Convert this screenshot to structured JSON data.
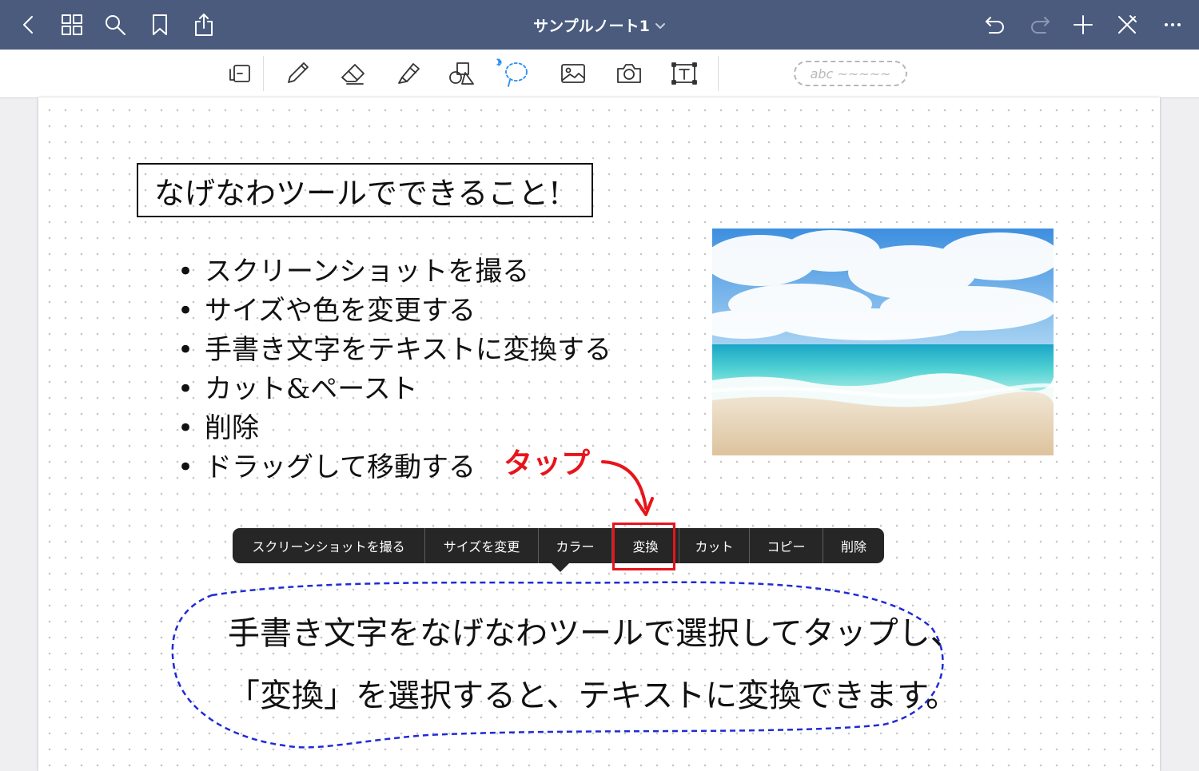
{
  "topbar": {
    "title": "サンプルノート1",
    "title_chevron": "chevron-down-icon",
    "left_icons": [
      "back-icon",
      "grid-icon",
      "search-icon",
      "bookmark-icon",
      "share-icon"
    ],
    "right_icons": [
      "undo-icon",
      "redo-icon",
      "plus-icon",
      "close-pen-icon",
      "more-icon"
    ]
  },
  "toolbar": {
    "tools": [
      "page-switch-icon",
      "pen-icon",
      "eraser-icon",
      "highlighter-icon",
      "shapes-icon",
      "lasso-icon",
      "image-icon",
      "camera-icon",
      "textbox-icon"
    ],
    "pill_text": "abc ~~~~~"
  },
  "canvas": {
    "title_text": "なげなわツールでできること!",
    "bullets": [
      "スクリーンショットを撮る",
      "サイズや色を変更する",
      "手書き文字をテキストに変換する",
      "カット&ペースト",
      "削除",
      "ドラッグして移動する"
    ],
    "tap_label": "タップ",
    "note_lines": [
      "手書き文字をなげなわツールで選択してタップし、",
      "「変換」を選択すると、テキストに変換できます。"
    ],
    "colors": {
      "annotation_red": "#e8141b",
      "lasso_blue": "#1f2bd6",
      "menu_bg": "#262626",
      "topbar_bg": "#4a5b7e"
    }
  },
  "context_menu": {
    "items": [
      "スクリーンショットを撮る",
      "サイズを変更",
      "カラー",
      "変換",
      "カット",
      "コピー",
      "削除"
    ],
    "highlighted": "変換"
  }
}
